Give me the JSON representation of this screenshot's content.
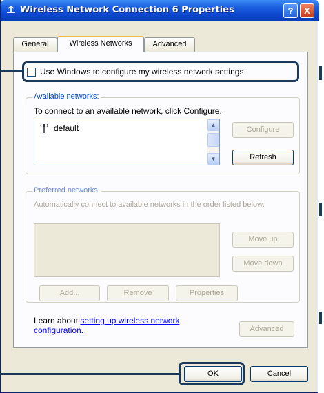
{
  "window": {
    "title": "Wireless Network Connection 6 Properties",
    "help_label": "?",
    "close_label": "X"
  },
  "tabs": [
    {
      "label": "General",
      "active": false
    },
    {
      "label": "Wireless Networks",
      "active": true
    },
    {
      "label": "Advanced",
      "active": false
    }
  ],
  "wireless_tab": {
    "use_windows_checkbox": {
      "label": "Use Windows to configure my wireless network settings",
      "checked": false
    },
    "available_networks": {
      "legend": "Available networks:",
      "instruction": "To connect to an available network, click Configure.",
      "items": [
        {
          "name": "default",
          "icon": "antenna-icon"
        }
      ],
      "configure_label": "Configure",
      "refresh_label": "Refresh"
    },
    "preferred_networks": {
      "legend": "Preferred networks:",
      "instruction": "Automatically connect to available networks in the order listed below:",
      "move_up_label": "Move up",
      "move_down_label": "Move down",
      "add_label": "Add...",
      "remove_label": "Remove",
      "properties_label": "Properties"
    },
    "learn_about": {
      "prefix": "Learn about ",
      "link": "setting up wireless network configuration."
    },
    "advanced_label": "Advanced"
  },
  "footer": {
    "ok_label": "OK",
    "cancel_label": "Cancel"
  },
  "colors": {
    "titlebar": "#0d48cf",
    "dialog_bg": "#ece9d8",
    "highlight_outline": "#1a3a5c",
    "link": "#0000ff"
  }
}
